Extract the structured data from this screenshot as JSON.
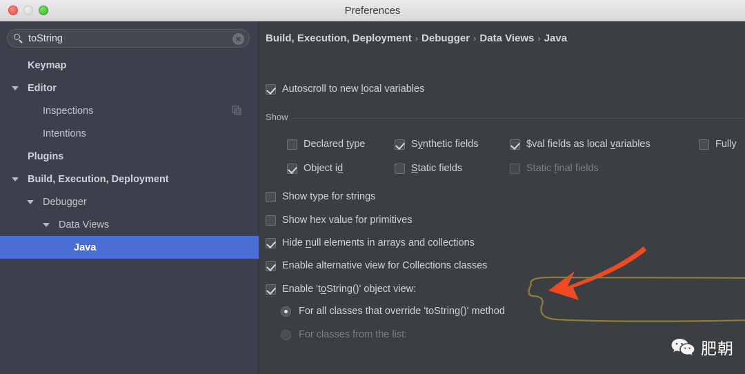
{
  "window": {
    "title": "Preferences",
    "traffic_lights": [
      {
        "name": "close",
        "color": "#ee5f56"
      },
      {
        "name": "minimize",
        "color": "#dddddd"
      },
      {
        "name": "zoom",
        "color": "#4bc13b"
      }
    ]
  },
  "search": {
    "value": "toString",
    "placeholder": "Search",
    "icon": "search-icon",
    "clear_icon": "clear-circle-icon"
  },
  "sidebar": {
    "items": [
      {
        "label": "Keymap",
        "indent": 40,
        "arrow": null,
        "bold": true,
        "selected": false,
        "extra_icon": null
      },
      {
        "label": "Editor",
        "indent": 40,
        "arrow": "down",
        "bold": true,
        "selected": false,
        "extra_icon": null
      },
      {
        "label": "Inspections",
        "indent": 62,
        "arrow": null,
        "bold": false,
        "selected": false,
        "extra_icon": "copy-icon"
      },
      {
        "label": "Intentions",
        "indent": 62,
        "arrow": null,
        "bold": false,
        "selected": false,
        "extra_icon": null
      },
      {
        "label": "Plugins",
        "indent": 40,
        "arrow": null,
        "bold": true,
        "selected": false,
        "extra_icon": null
      },
      {
        "label": "Build, Execution, Deployment",
        "indent": 40,
        "arrow": "down",
        "bold": true,
        "selected": false,
        "extra_icon": null
      },
      {
        "label": "Debugger",
        "indent": 62,
        "arrow": "down",
        "bold": false,
        "selected": false,
        "extra_icon": null
      },
      {
        "label": "Data Views",
        "indent": 85,
        "arrow": "down",
        "bold": false,
        "selected": false,
        "extra_icon": null
      },
      {
        "label": "Java",
        "indent": 107,
        "arrow": null,
        "bold": true,
        "selected": true,
        "extra_icon": null
      }
    ]
  },
  "breadcrumb": {
    "parts": [
      "Build, Execution, Deployment",
      "Debugger",
      "Data Views",
      "Java"
    ],
    "separator": "›"
  },
  "main": {
    "autoscroll": {
      "label": "Autoscroll to new ",
      "mnemonic": "l",
      "label_tail": "ocal variables",
      "checked": true,
      "disabled": false
    },
    "show_group": {
      "label": "Show",
      "items": [
        {
          "label_pre": "Declared ",
          "mnemonic": "t",
          "label_post": "ype",
          "checked": false,
          "disabled": false,
          "col": 0,
          "row": 0
        },
        {
          "label_pre": "S",
          "mnemonic": "y",
          "label_post": "nthetic fields",
          "checked": true,
          "disabled": false,
          "col": 1,
          "row": 0
        },
        {
          "label_pre": "$val fields as local ",
          "mnemonic": "v",
          "label_post": "ariables",
          "checked": true,
          "disabled": false,
          "col": 2,
          "row": 0
        },
        {
          "label_pre": "Fully ",
          "mnemonic": "",
          "label_post": "",
          "checked": false,
          "disabled": false,
          "col": 3,
          "row": 0
        },
        {
          "label_pre": "Object i",
          "mnemonic": "d",
          "label_post": "",
          "checked": true,
          "disabled": false,
          "col": 0,
          "row": 1
        },
        {
          "label_pre": "",
          "mnemonic": "S",
          "label_post": "tatic fields",
          "checked": false,
          "disabled": false,
          "col": 1,
          "row": 1
        },
        {
          "label_pre": "Static ",
          "mnemonic": "f",
          "label_post": "inal fields",
          "checked": false,
          "disabled": true,
          "col": 2,
          "row": 1
        }
      ]
    },
    "options": [
      {
        "label_pre": "Show type for strings",
        "mnemonic": "",
        "label_post": "",
        "checked": false,
        "disabled": false
      },
      {
        "label_pre": "Show hex value for primitives",
        "mnemonic": "",
        "label_post": "",
        "checked": false,
        "disabled": false
      },
      {
        "label_pre": "Hide ",
        "mnemonic": "n",
        "label_post": "ull elements in arrays and collections",
        "checked": true,
        "disabled": false
      },
      {
        "label_pre": "Enable alternative view for Collections classes",
        "mnemonic": "",
        "label_post": "",
        "checked": true,
        "disabled": false
      }
    ],
    "tostring": {
      "label_pre": "Enable 't",
      "mnemonic": "o",
      "label_post": "String()' object view:",
      "checked": true,
      "radios": [
        {
          "label": "For all classes that override 'toString()' method",
          "selected": true,
          "disabled": false
        },
        {
          "label": "For classes from the list:",
          "selected": false,
          "disabled": true
        }
      ]
    }
  },
  "annotations": {
    "arrow_color": "#f04a23",
    "callout_color": "#8f7d3c",
    "arrow_name": "red-pointer-arrow",
    "callout_name": "highlight-outline"
  },
  "watermark": {
    "text": "肥朝",
    "icon": "wechat-icon"
  },
  "colors": {
    "selection_blue": "#4a6dd6",
    "sidebar_bg": "#3c3f4c",
    "content_bg": "#3c3f41",
    "titlebar_bg": "#e6e4e6"
  }
}
